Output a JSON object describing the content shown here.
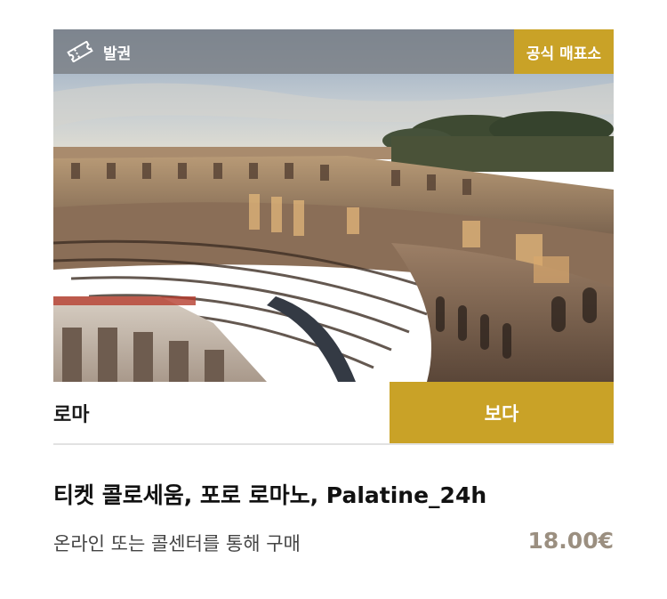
{
  "card": {
    "ticket_label": "발권",
    "official_badge": "공식 매표소",
    "city": "로마",
    "view_button": "보다",
    "title": "티켓 콜로세움, 포로 로마노, Palatine_24h",
    "subtitle": "온라인 또는 콜센터를 통해 구매",
    "price": "18.00€"
  },
  "icons": {
    "ticket": "ticket-icon"
  },
  "colors": {
    "accent": "#c9a227",
    "top_bar": "#7d8087",
    "price": "#9b8f80",
    "divider": "#e2e2e2"
  }
}
